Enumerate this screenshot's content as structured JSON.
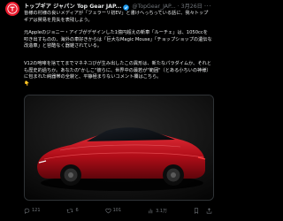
{
  "tweet": {
    "name": "トップギア ジャパン Top Gear JAP...",
    "handle": "@TopGear_JAP...",
    "separator": "·",
    "time": "3月26日",
    "more": "···",
    "paragraphs": [
      "皆様の村様の良いメディアが「フェラーリ初EV」と書けへっちっている話に、我々トップギアは賛易を見失を表残しよう。",
      "元Appleのジョニー・アイブがデザインした1億円超えの新車「ルーチェ」は、1050ccを叩き出すものの、海外の車好きからは「巨大なMagic Mouse」「チョップショップの遺伝な改造車」と容酷なく器雑されている。",
      "V12の咆哮を捨ててまでマネネコびが生み出したこの異形は、新たなパラダイムか、それとも歴史的過ちか。あなたの\"かしこ\"彼らに、世界中の最若が\"範囲\"（とある小ちいの神様）に包まれた純器帯の全貌と、平静極まりないコメント欄はこちら。"
    ],
    "emoji": "👇",
    "actions": {
      "reply": "121",
      "retweet": "6",
      "like": "101",
      "views": "3.1万"
    }
  },
  "colors": {
    "background": "#000000",
    "text": "#e7e9ea",
    "muted": "#71767b",
    "verified": "#1d9bf0",
    "avatar": "#e8192c",
    "car": "#c8101c"
  },
  "icons": [
    "topgear-logo-icon",
    "verified-badge-icon",
    "reply-icon",
    "retweet-icon",
    "like-icon",
    "views-icon",
    "bookmark-icon",
    "share-icon"
  ]
}
